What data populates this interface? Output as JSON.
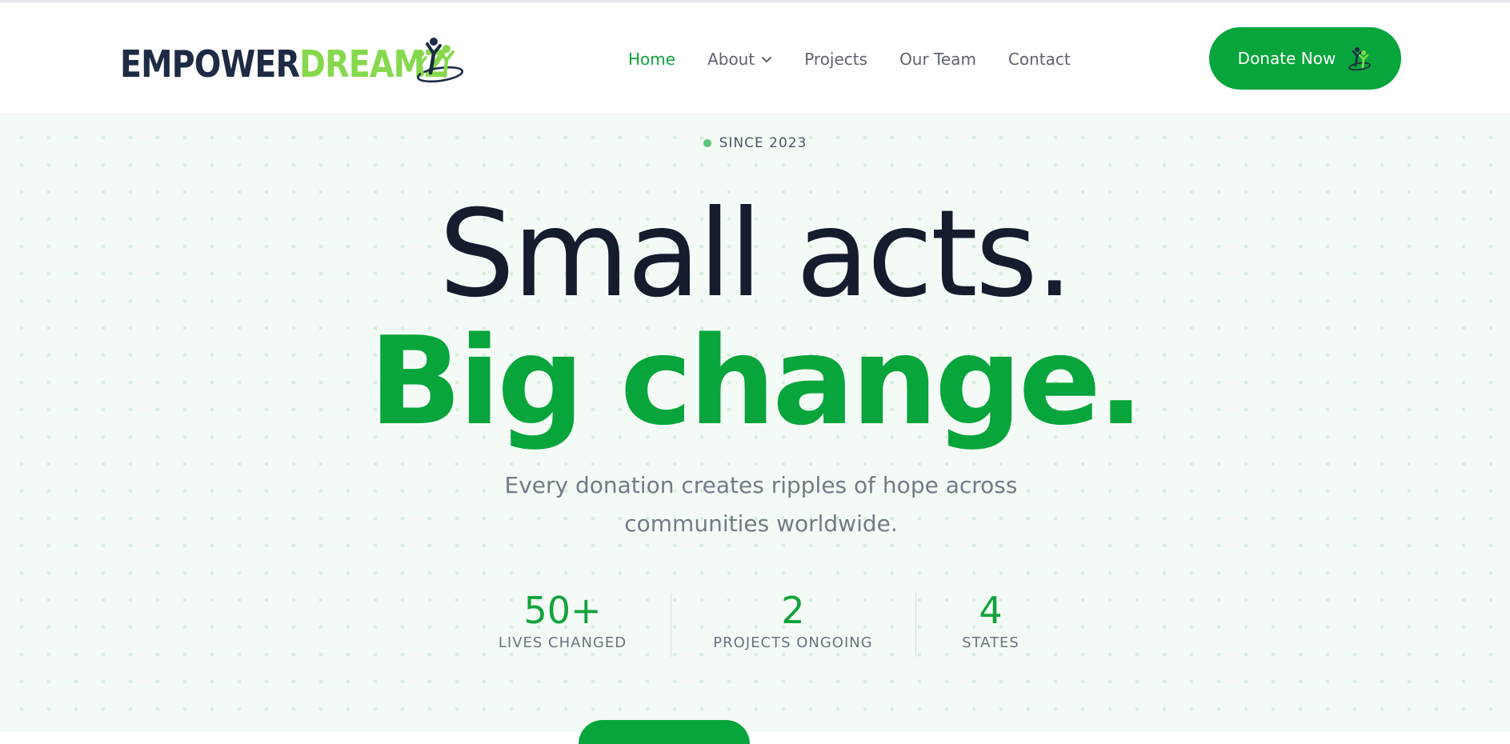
{
  "brand": {
    "name_part1": "EMPOWER",
    "name_part2": "DREAMZ",
    "colors": {
      "primary_green": "#07a53b",
      "light_green": "#86d94e",
      "navy": "#1d2b45"
    }
  },
  "nav": {
    "items": [
      {
        "label": "Home",
        "active": true
      },
      {
        "label": "About",
        "has_dropdown": true
      },
      {
        "label": "Projects"
      },
      {
        "label": "Our Team"
      },
      {
        "label": "Contact"
      }
    ]
  },
  "header": {
    "donate_label": "Donate Now",
    "donate_icon": "people-icon"
  },
  "hero": {
    "since": "SINCE 2023",
    "headline_line1": "Small acts.",
    "headline_line2": "Big change.",
    "subtitle": "Every donation creates ripples of hope across communities worldwide."
  },
  "stats": [
    {
      "value": "50+",
      "label": "LIVES CHANGED"
    },
    {
      "value": "2",
      "label": "PROJECTS ONGOING"
    },
    {
      "value": "4",
      "label": "STATES"
    }
  ]
}
